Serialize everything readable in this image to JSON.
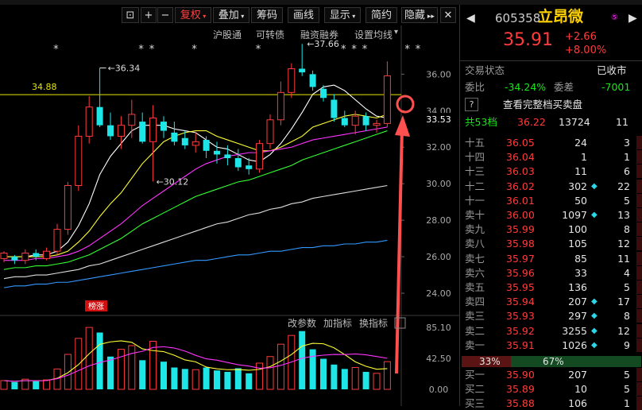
{
  "toolbar": {
    "buttons": [
      "复权",
      "叠加",
      "筹码",
      "画线",
      "显示",
      "简约",
      "隐藏"
    ],
    "active_fuquan": "复权",
    "sub_buttons": [
      "沪股通",
      "可转债",
      "融资融券",
      "设置均线"
    ]
  },
  "price_axis": [
    "36.00",
    "34.00",
    "32.00",
    "30.00",
    "28.00",
    "26.00",
    "24.00"
  ],
  "current_price_label": "33.53",
  "hline_label": "34.88",
  "annotations": {
    "high1": "36.34",
    "low1": "30.12",
    "high2": "37.66"
  },
  "badge": "榜涨",
  "volume_panel": {
    "controls": [
      "改参数",
      "加指标",
      "换指标"
    ],
    "axis": [
      "85.10",
      "42.50",
      "0.00"
    ]
  },
  "quote": {
    "code": "605358",
    "name": "立昂微",
    "price": "35.91",
    "change": "+2.66",
    "change_pct": "+8.00%",
    "status_label": "交易状态",
    "status_value": "已收市",
    "weibi_label": "委比",
    "weibi_value": "-34.24%",
    "weicha_label": "委差",
    "weicha_value": "-7001",
    "full_book_label": "查看完整档买卖盘",
    "total_label": "共53档",
    "total_price": "36.22",
    "total_vol": "13724",
    "total_count": "11",
    "asks": [
      {
        "label": "十五",
        "price": "36.05",
        "vol": "24",
        "cnt": "3",
        "diamond": false
      },
      {
        "label": "十四",
        "price": "36.04",
        "vol": "1",
        "cnt": "1",
        "diamond": false
      },
      {
        "label": "十三",
        "price": "36.03",
        "vol": "11",
        "cnt": "6",
        "diamond": false
      },
      {
        "label": "十二",
        "price": "36.02",
        "vol": "302",
        "cnt": "22",
        "diamond": true
      },
      {
        "label": "十一",
        "price": "36.01",
        "vol": "50",
        "cnt": "5",
        "diamond": false
      },
      {
        "label": "卖十",
        "price": "36.00",
        "vol": "1097",
        "cnt": "13",
        "diamond": true
      },
      {
        "label": "卖九",
        "price": "35.99",
        "vol": "100",
        "cnt": "8",
        "diamond": false
      },
      {
        "label": "卖八",
        "price": "35.98",
        "vol": "105",
        "cnt": "12",
        "diamond": false
      },
      {
        "label": "卖七",
        "price": "35.97",
        "vol": "85",
        "cnt": "11",
        "diamond": false
      },
      {
        "label": "卖六",
        "price": "35.96",
        "vol": "33",
        "cnt": "4",
        "diamond": false
      },
      {
        "label": "卖五",
        "price": "35.95",
        "vol": "136",
        "cnt": "5",
        "diamond": false
      },
      {
        "label": "卖四",
        "price": "35.94",
        "vol": "207",
        "cnt": "17",
        "diamond": true
      },
      {
        "label": "卖三",
        "price": "35.93",
        "vol": "297",
        "cnt": "8",
        "diamond": true
      },
      {
        "label": "卖二",
        "price": "35.92",
        "vol": "3255",
        "cnt": "12",
        "diamond": true
      },
      {
        "label": "卖一",
        "price": "35.91",
        "vol": "1026",
        "cnt": "9",
        "diamond": true
      }
    ],
    "ratio_left": "33%",
    "ratio_right": "67%",
    "bids": [
      {
        "label": "买一",
        "price": "35.90",
        "vol": "207",
        "cnt": "5",
        "diamond": false
      },
      {
        "label": "买二",
        "price": "35.89",
        "vol": "10",
        "cnt": "5",
        "diamond": false
      },
      {
        "label": "买三",
        "price": "35.88",
        "vol": "106",
        "cnt": "1",
        "diamond": false
      }
    ],
    "colors": {
      "up": "#ff3b3b",
      "down": "#19e619",
      "accent": "#28d7e8"
    }
  },
  "chart_data": {
    "type": "candlestick",
    "ylim": [
      23,
      37.8
    ],
    "candles": [
      {
        "o": 25.9,
        "h": 26.3,
        "l": 25.7,
        "c": 26.2
      },
      {
        "o": 26.0,
        "h": 26.1,
        "l": 25.6,
        "c": 25.8
      },
      {
        "o": 25.8,
        "h": 26.4,
        "l": 25.6,
        "c": 26.2
      },
      {
        "o": 26.2,
        "h": 26.4,
        "l": 25.8,
        "c": 26.0
      },
      {
        "o": 25.9,
        "h": 26.5,
        "l": 25.8,
        "c": 26.3
      },
      {
        "o": 26.3,
        "h": 27.8,
        "l": 26.1,
        "c": 27.5
      },
      {
        "o": 27.5,
        "h": 30.1,
        "l": 27.2,
        "c": 29.9
      },
      {
        "o": 29.9,
        "h": 33.2,
        "l": 29.6,
        "c": 32.6
      },
      {
        "o": 32.6,
        "h": 34.8,
        "l": 32.2,
        "c": 34.2
      },
      {
        "o": 34.2,
        "h": 36.34,
        "l": 33.1,
        "c": 33.2
      },
      {
        "o": 33.2,
        "h": 33.9,
        "l": 32.4,
        "c": 32.6
      },
      {
        "o": 32.6,
        "h": 33.7,
        "l": 31.9,
        "c": 33.2
      },
      {
        "o": 33.2,
        "h": 34.6,
        "l": 32.5,
        "c": 33.8
      },
      {
        "o": 33.4,
        "h": 33.9,
        "l": 32.2,
        "c": 32.3
      },
      {
        "o": 32.3,
        "h": 34.3,
        "l": 30.12,
        "c": 33.6
      },
      {
        "o": 33.4,
        "h": 33.7,
        "l": 32.5,
        "c": 32.9
      },
      {
        "o": 32.8,
        "h": 33.4,
        "l": 32.1,
        "c": 32.3
      },
      {
        "o": 32.5,
        "h": 32.9,
        "l": 31.9,
        "c": 32.1
      },
      {
        "o": 32.1,
        "h": 32.8,
        "l": 31.7,
        "c": 32.3
      },
      {
        "o": 32.4,
        "h": 32.6,
        "l": 31.4,
        "c": 31.8
      },
      {
        "o": 31.8,
        "h": 32.3,
        "l": 31.1,
        "c": 31.6
      },
      {
        "o": 31.6,
        "h": 32.1,
        "l": 31.0,
        "c": 31.4
      },
      {
        "o": 31.4,
        "h": 31.9,
        "l": 30.7,
        "c": 30.9
      },
      {
        "o": 31.0,
        "h": 31.4,
        "l": 30.5,
        "c": 30.8
      },
      {
        "o": 30.8,
        "h": 32.4,
        "l": 30.6,
        "c": 32.2
      },
      {
        "o": 32.2,
        "h": 33.8,
        "l": 31.9,
        "c": 33.5
      },
      {
        "o": 33.5,
        "h": 35.6,
        "l": 33.2,
        "c": 35.0
      },
      {
        "o": 35.0,
        "h": 36.6,
        "l": 34.7,
        "c": 36.3
      },
      {
        "o": 36.3,
        "h": 37.66,
        "l": 35.9,
        "c": 36.1
      },
      {
        "o": 36.0,
        "h": 36.2,
        "l": 35.1,
        "c": 35.3
      },
      {
        "o": 35.2,
        "h": 35.4,
        "l": 34.5,
        "c": 34.7
      },
      {
        "o": 34.6,
        "h": 34.9,
        "l": 33.4,
        "c": 33.6
      },
      {
        "o": 33.6,
        "h": 34.0,
        "l": 33.1,
        "c": 33.2
      },
      {
        "o": 33.2,
        "h": 34.0,
        "l": 32.7,
        "c": 33.7
      },
      {
        "o": 33.7,
        "h": 33.9,
        "l": 32.9,
        "c": 33.2
      },
      {
        "o": 33.2,
        "h": 33.5,
        "l": 32.8,
        "c": 33.3
      },
      {
        "o": 33.3,
        "h": 36.7,
        "l": 33.1,
        "c": 35.91
      }
    ],
    "ma": [
      {
        "name": "MA5",
        "color": "#ffffff",
        "values": [
          26.0,
          26.0,
          26.0,
          26.1,
          26.1,
          26.3,
          26.8,
          27.7,
          28.9,
          30.5,
          31.5,
          32.2,
          32.9,
          33.2,
          33.2,
          33.2,
          33.0,
          32.9,
          32.8,
          32.4,
          32.0,
          31.9,
          31.6,
          31.3,
          31.2,
          31.6,
          32.2,
          33.0,
          33.9,
          34.9,
          35.3,
          35.4,
          35.1,
          34.6,
          34.1,
          33.7,
          33.6
        ]
      },
      {
        "name": "MA10",
        "color": "#ffff33",
        "values": [
          26.0,
          26.0,
          26.0,
          26.0,
          26.0,
          26.1,
          26.3,
          26.8,
          27.4,
          28.2,
          28.9,
          29.5,
          30.3,
          31.1,
          31.7,
          32.3,
          32.6,
          32.8,
          32.9,
          32.9,
          32.6,
          32.4,
          32.2,
          32.0,
          31.8,
          31.8,
          32.0,
          32.3,
          32.6,
          33.1,
          33.3,
          33.5,
          33.7,
          33.8,
          33.7,
          33.6,
          33.8
        ]
      },
      {
        "name": "MA20",
        "color": "#ff33ff",
        "values": [
          25.8,
          25.8,
          25.8,
          25.9,
          25.9,
          26.0,
          26.1,
          26.3,
          26.6,
          27.0,
          27.4,
          27.8,
          28.3,
          28.8,
          29.2,
          29.6,
          30.0,
          30.4,
          30.8,
          31.1,
          31.3,
          31.5,
          31.6,
          31.7,
          31.7,
          31.8,
          31.9,
          32.0,
          32.2,
          32.4,
          32.5,
          32.6,
          32.7,
          32.8,
          32.9,
          33.0,
          33.1
        ]
      },
      {
        "name": "MA30",
        "color": "#33ff33",
        "values": [
          25.3,
          25.4,
          25.4,
          25.5,
          25.5,
          25.6,
          25.7,
          25.9,
          26.1,
          26.4,
          26.7,
          27.0,
          27.4,
          27.8,
          28.1,
          28.4,
          28.7,
          29.0,
          29.3,
          29.5,
          29.7,
          29.9,
          30.1,
          30.2,
          30.4,
          30.6,
          30.8,
          31.0,
          31.3,
          31.5,
          31.7,
          31.9,
          32.1,
          32.3,
          32.5,
          32.7,
          32.9
        ]
      },
      {
        "name": "MA60",
        "color": "#dddddd",
        "values": [
          24.8,
          24.9,
          24.9,
          25.0,
          25.0,
          25.1,
          25.2,
          25.3,
          25.5,
          25.6,
          25.8,
          26.0,
          26.2,
          26.4,
          26.6,
          26.8,
          27.0,
          27.2,
          27.4,
          27.6,
          27.8,
          27.9,
          28.1,
          28.3,
          28.4,
          28.6,
          28.7,
          28.9,
          29.0,
          29.2,
          29.3,
          29.4,
          29.5,
          29.6,
          29.7,
          29.8,
          29.9
        ]
      },
      {
        "name": "MA120",
        "color": "#3399ff",
        "values": [
          24.3,
          24.4,
          24.4,
          24.5,
          24.5,
          24.6,
          24.6,
          24.7,
          24.8,
          24.9,
          25.0,
          25.1,
          25.2,
          25.3,
          25.4,
          25.5,
          25.6,
          25.7,
          25.8,
          25.8,
          25.9,
          26.0,
          26.1,
          26.1,
          26.2,
          26.3,
          26.3,
          26.4,
          26.5,
          26.5,
          26.6,
          26.6,
          26.7,
          26.7,
          26.8,
          26.8,
          26.9
        ]
      }
    ],
    "volume": {
      "ylim": [
        0,
        85.1
      ],
      "values": [
        12,
        10,
        14,
        11,
        13,
        28,
        48,
        70,
        85,
        78,
        45,
        55,
        60,
        40,
        66,
        38,
        30,
        28,
        27,
        30,
        26,
        24,
        29,
        22,
        36,
        45,
        62,
        74,
        80,
        55,
        42,
        34,
        28,
        30,
        24,
        22,
        38
      ]
    }
  }
}
